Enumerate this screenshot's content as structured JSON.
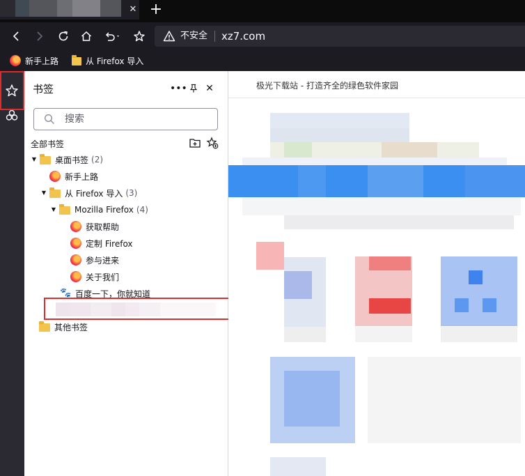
{
  "browser": {
    "new_tab_symbol": "+",
    "tab_close_symbol": "✕",
    "url": {
      "security_label": "不安全",
      "host": "xz7.com"
    }
  },
  "bookmarks_toolbar": {
    "items": [
      {
        "label": "新手上路",
        "icon": "firefox-icon"
      },
      {
        "label": "从 Firefox 导入",
        "icon": "folder-icon"
      }
    ]
  },
  "sidebar": {
    "title": "书签",
    "more_symbol": "•••",
    "close_symbol": "✕",
    "search_placeholder": "搜索",
    "all_bookmarks_label": "全部书签",
    "tree": {
      "desktop": {
        "label": "桌面书签",
        "count": "(2)"
      },
      "getting_started": {
        "label": "新手上路"
      },
      "import": {
        "label": "从 Firefox 导入",
        "count": "(3)"
      },
      "mozilla": {
        "label": "Mozilla Firefox",
        "count": "(4)"
      },
      "help": {
        "label": "获取帮助"
      },
      "customize": {
        "label": "定制 Firefox"
      },
      "involved": {
        "label": "参与进来"
      },
      "about": {
        "label": "关于我们"
      },
      "baidu": {
        "label": "百度一下，你就知道"
      },
      "other": {
        "label": "其他书签"
      }
    }
  },
  "content": {
    "page_title": "极光下载站 - 打造齐全的绿色软件家园"
  },
  "colors": {
    "highlight": "#e02b2b",
    "toolbar_bg": "#1c1b22",
    "folder": "#f3c44d"
  }
}
